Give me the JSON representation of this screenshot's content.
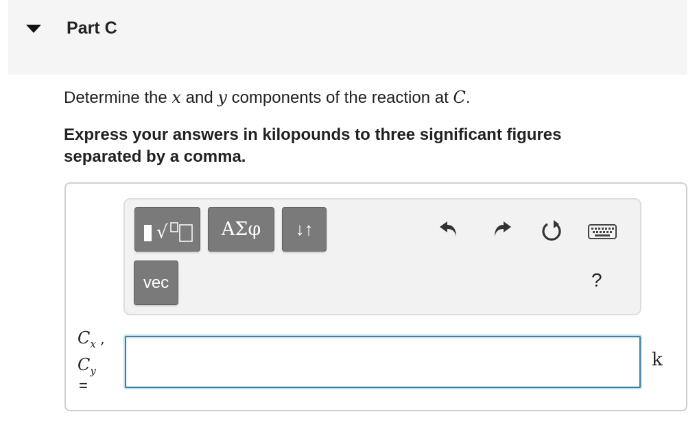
{
  "part": {
    "title": "Part C"
  },
  "question": {
    "prefix": "Determine the ",
    "var_x": "x",
    "mid": " and ",
    "var_y": "y",
    "suffix": " components of the reaction at ",
    "point": "C",
    "end": "."
  },
  "instructions": "Express your answers in kilopounds to three significant figures separated by a comma.",
  "toolbar": {
    "greek_label": "ΑΣφ",
    "arrows_label": "↓↑",
    "vec_label": "vec",
    "help_label": "?",
    "icons": [
      "templates-icon",
      "undo-icon",
      "redo-icon",
      "reset-icon",
      "keyboard-icon"
    ]
  },
  "answer": {
    "var1": "C",
    "var1_sub": "x",
    "separator": " ,",
    "var2": "C",
    "var2_sub": "y",
    "equals": "=",
    "value": "",
    "unit": "k"
  },
  "colors": {
    "header_bg": "#f5f5f5",
    "button_bg": "#7a7a7a",
    "input_border": "#3f7f9f"
  }
}
